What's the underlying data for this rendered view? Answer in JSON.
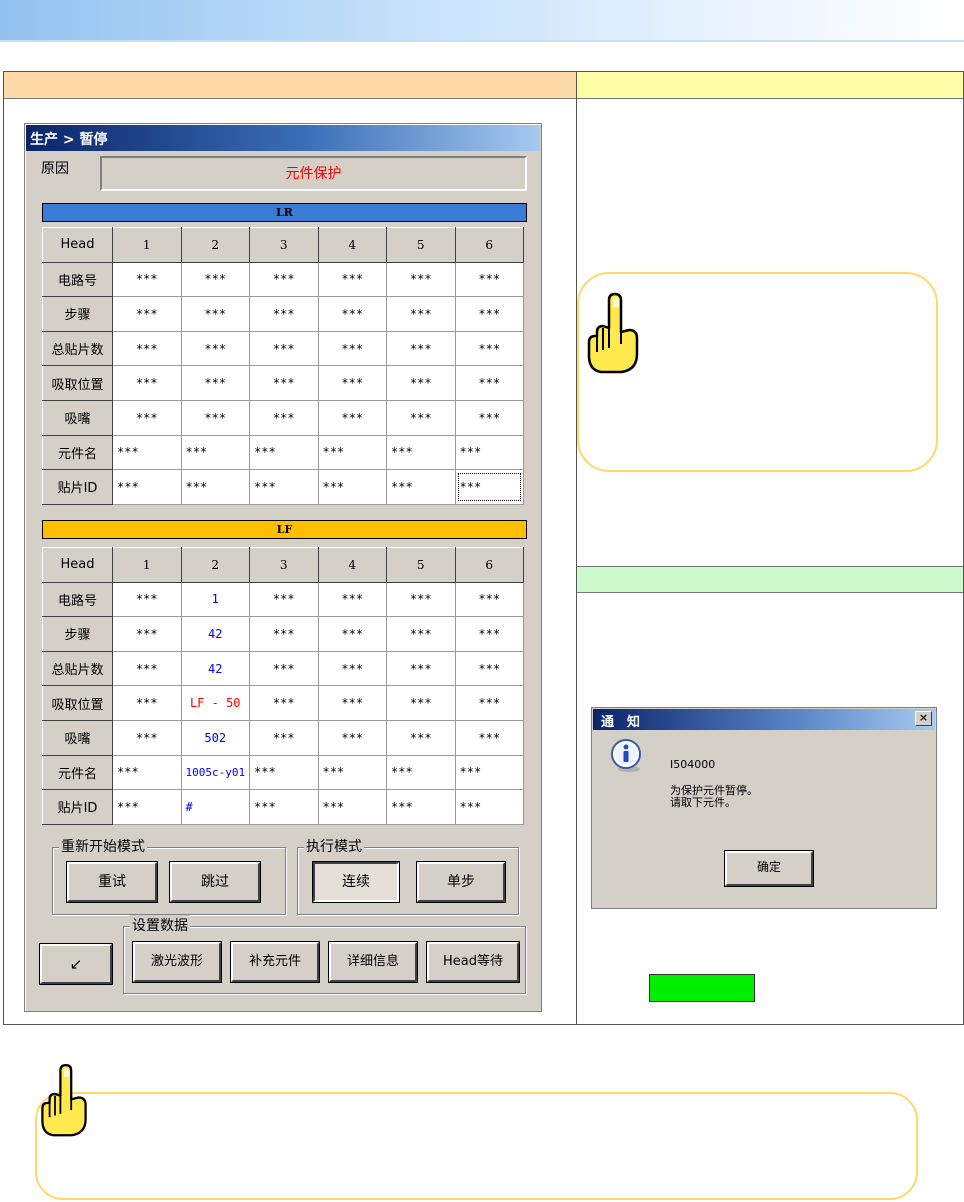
{
  "dialog": {
    "title": "生产 > 暂停",
    "reason_label": "原因",
    "reason_value": "元件保护"
  },
  "lr_table": {
    "title": "LR",
    "columns": [
      "Head",
      "1",
      "2",
      "3",
      "4",
      "5",
      "6"
    ],
    "rows": [
      {
        "label": "电路号",
        "values": [
          "***",
          "***",
          "***",
          "***",
          "***",
          "***"
        ]
      },
      {
        "label": "步骤",
        "values": [
          "***",
          "***",
          "***",
          "***",
          "***",
          "***"
        ]
      },
      {
        "label": "总贴片数",
        "values": [
          "***",
          "***",
          "***",
          "***",
          "***",
          "***"
        ]
      },
      {
        "label": "吸取位置",
        "values": [
          "***",
          "***",
          "***",
          "***",
          "***",
          "***"
        ]
      },
      {
        "label": "吸嘴",
        "values": [
          "***",
          "***",
          "***",
          "***",
          "***",
          "***"
        ]
      },
      {
        "label": "元件名",
        "values": [
          "***",
          "***",
          "***",
          "***",
          "***",
          "***"
        ]
      },
      {
        "label": "贴片ID",
        "values": [
          "***",
          "***",
          "***",
          "***",
          "***",
          "***"
        ]
      }
    ]
  },
  "lf_table": {
    "title": "LF",
    "columns": [
      "Head",
      "1",
      "2",
      "3",
      "4",
      "5",
      "6"
    ],
    "rows": [
      {
        "label": "电路号",
        "values": [
          "***",
          "1",
          "***",
          "***",
          "***",
          "***"
        ]
      },
      {
        "label": "步骤",
        "values": [
          "***",
          "42",
          "***",
          "***",
          "***",
          "***"
        ]
      },
      {
        "label": "总贴片数",
        "values": [
          "***",
          "42",
          "***",
          "***",
          "***",
          "***"
        ]
      },
      {
        "label": "吸取位置",
        "values": [
          "***",
          "LF - 50",
          "***",
          "***",
          "***",
          "***"
        ]
      },
      {
        "label": "吸嘴",
        "values": [
          "***",
          "502",
          "***",
          "***",
          "***",
          "***"
        ]
      },
      {
        "label": "元件名",
        "values": [
          "***",
          "1005c-y01",
          "***",
          "***",
          "***",
          "***"
        ]
      },
      {
        "label": "贴片ID",
        "values": [
          "***",
          "#",
          "***",
          "***",
          "***",
          "***"
        ]
      }
    ]
  },
  "restart_mode": {
    "label": "重新开始模式",
    "retry": "重试",
    "skip": "跳过"
  },
  "run_mode": {
    "label": "执行模式",
    "continuous": "连续",
    "single_step": "单步"
  },
  "settings": {
    "label": "设置数据",
    "laser_waveform": "激光波形",
    "supplement": "补充元件",
    "details": "详细信息",
    "head_wait": "Head等待",
    "corner_glyph": "↙"
  },
  "notice": {
    "title": "通　知",
    "close_glyph": "×",
    "code": "I504000",
    "message_line1": "为保护元件暂停。",
    "message_line2": "请取下元件。",
    "ok": "确定"
  },
  "colors": {
    "lr_bar": "#3a7cd5",
    "lf_bar": "#ffbf00",
    "reason_text": "#ff0000",
    "highlight_blue": "#0000ff",
    "highlight_red": "#ff0000",
    "green_button": "#00f000"
  },
  "icons": [
    "pointing-hand-icon",
    "info-icon",
    "close-icon",
    "resize-icon"
  ]
}
